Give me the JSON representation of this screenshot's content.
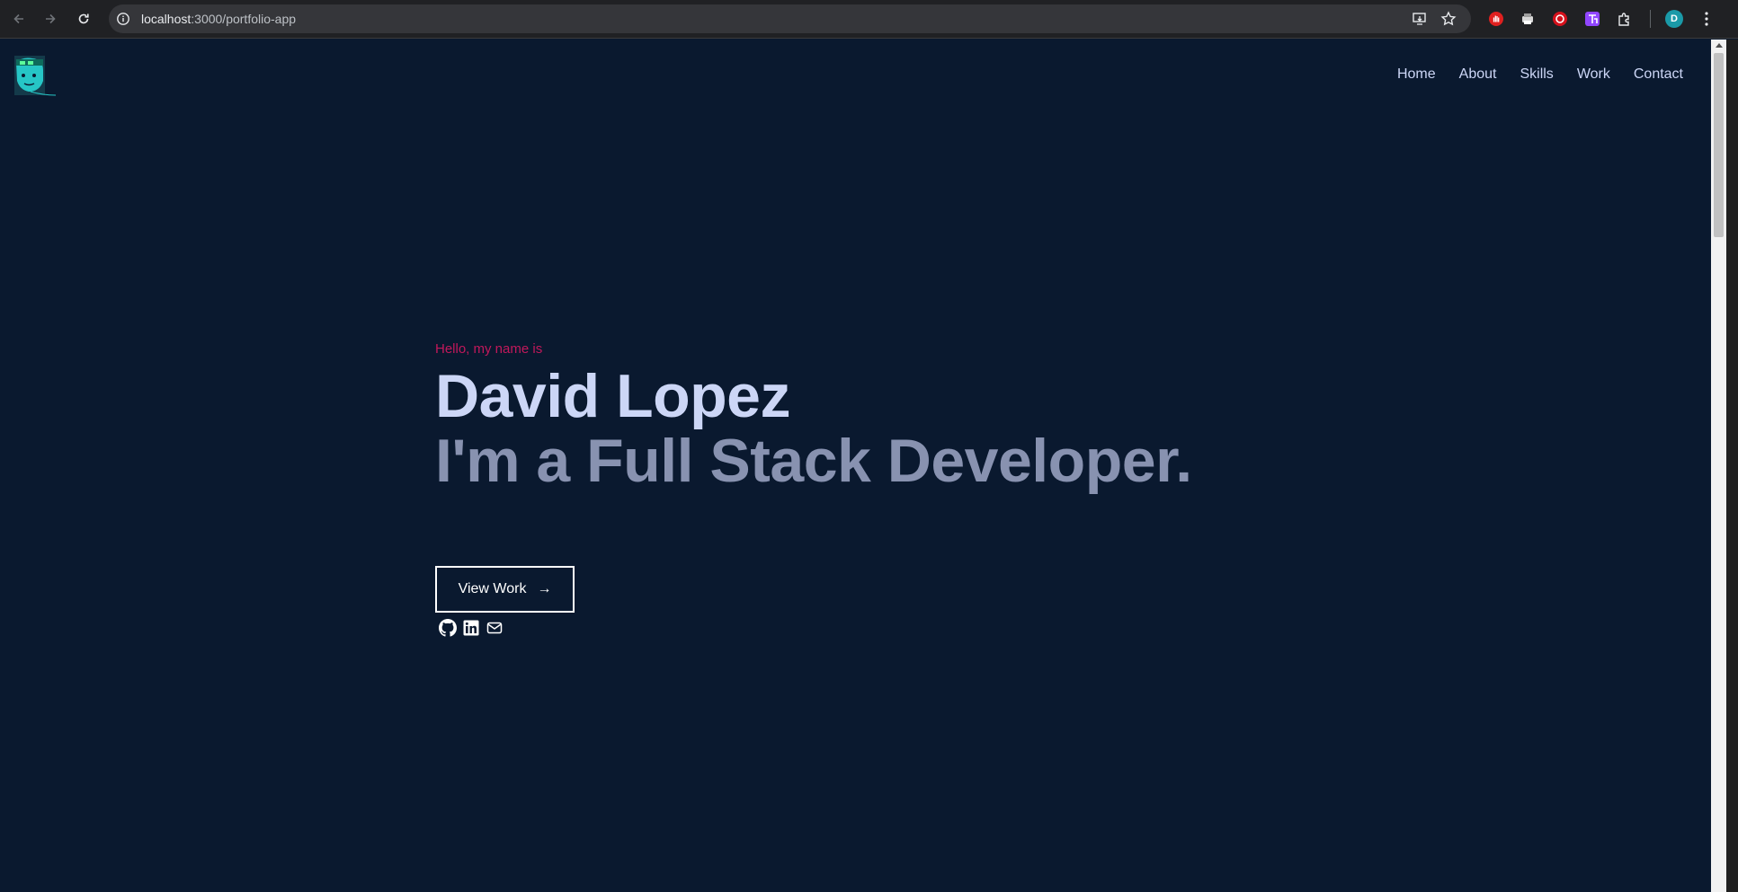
{
  "browser": {
    "url_host": "localhost",
    "url_path": ":3000/portfolio-app",
    "profile_initial": "D"
  },
  "site": {
    "nav": [
      "Home",
      "About",
      "Skills",
      "Work",
      "Contact"
    ]
  },
  "hero": {
    "greeting": "Hello, my name is",
    "name": "David Lopez",
    "tagline": "I'm a Full Stack Developer.",
    "cta_label": "View Work",
    "cta_arrow": "→"
  },
  "social_icons": [
    "github-icon",
    "linkedin-icon",
    "mail-icon"
  ],
  "colors": {
    "background": "#0a192f",
    "accent": "#c2185b",
    "heading": "#ccd6f6",
    "subheading": "#8892b0"
  }
}
